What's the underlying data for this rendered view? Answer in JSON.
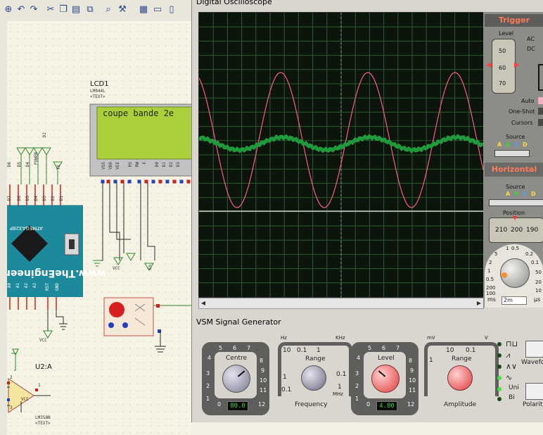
{
  "toolbar": {
    "icons": [
      "zoom-icon",
      "undo-icon",
      "redo-icon",
      "cut-icon",
      "copy-icon",
      "paste-icon",
      "tool-icon",
      "schematic-icon",
      "find-icon",
      "settings-icon",
      "netlist-icon",
      "file-icon",
      "page-icon"
    ]
  },
  "schematic": {
    "lcd": {
      "ref": "LCD1",
      "model": "LM044L",
      "text_tag": "<TEXT>",
      "display": "coupe bande 2e",
      "pins": [
        "VSS",
        "VDD",
        "VEE",
        "RS",
        "RW",
        "E",
        "D0",
        "D1",
        "D2",
        "D3"
      ]
    },
    "arduino": {
      "brand": "www.TheEngineer",
      "chip": "ATMEGA328P"
    },
    "arduino_top_pins": [
      "D9",
      "D8",
      "D7",
      "D6",
      "D5",
      "D4",
      "D3",
      "D2",
      "D1",
      "D0"
    ],
    "arduino_top_labels": [
      "D6",
      "D5",
      "D4",
      "POWER",
      "D2",
      "TX"
    ],
    "arduino_bottom_pins": [
      "A0",
      "A1",
      "A2",
      "A3",
      "A4",
      "A5",
      "RST",
      "GND"
    ],
    "net_vcc": "VCC",
    "net_en": "En",
    "opamp": {
      "ref": "U2:A",
      "model": "LM358N",
      "text_tag": "<TEXT>",
      "pin_out": "1",
      "pin_in": "2",
      "pin_in2": "3",
      "vcc": "VCC"
    }
  },
  "oscilloscope": {
    "title": "Digital Oscilloscope",
    "trigger": {
      "title": "Trigger",
      "level_label": "Level",
      "level_ticks": [
        "50",
        "60",
        "70"
      ],
      "ac": "AC",
      "dc": "DC",
      "auto": "Auto",
      "one_shot": "One-Shot",
      "cursors": "Cursors",
      "source": "Source",
      "channels": [
        "A",
        "B",
        "C",
        "D"
      ]
    },
    "horizontal": {
      "title": "Horizontal",
      "source": "Source",
      "channels": [
        "A",
        "B",
        "C",
        "D"
      ],
      "position": "Position",
      "position_values": [
        "210",
        "200",
        "190"
      ],
      "dial_ticks": [
        "1",
        "0.5",
        "0.2",
        "0.1",
        "50",
        "20",
        "10",
        "5",
        "2",
        "1",
        "0.5",
        "200",
        "100"
      ],
      "units": [
        "ms",
        "µs"
      ],
      "timebase_value": "2m"
    },
    "channel_a_color": "#ff5a8a",
    "channel_b_color": "#1f9b3c"
  },
  "generator": {
    "title": "VSM Signal Generator",
    "centre": {
      "label": "Centre",
      "scale": [
        "5",
        "6",
        "7",
        "4",
        "8",
        "3",
        "9",
        "2",
        "10",
        "1",
        "11",
        "0",
        "12"
      ],
      "value": "80.0"
    },
    "freq_range": {
      "label": "Range",
      "top": [
        "0.1",
        "1"
      ],
      "left": [
        "10",
        "1",
        "0.1"
      ],
      "right": [
        "0.1",
        "1"
      ],
      "hz": "Hz",
      "khz": "KHz",
      "mhz": "MHz",
      "caption": "Frequency"
    },
    "level": {
      "label": "Level",
      "scale": [
        "5",
        "6",
        "7",
        "4",
        "8",
        "3",
        "9",
        "2",
        "10",
        "1",
        "11",
        "0",
        "12"
      ],
      "value": "4.80"
    },
    "amp_range": {
      "label": "Range",
      "top": [
        "10",
        "0.1"
      ],
      "left": [
        "1"
      ],
      "mv": "mV",
      "v": "V",
      "caption": "Amplitude"
    },
    "waveform_caption": "Wavefor",
    "polarity": {
      "uni": "Uni",
      "bi": "Bi",
      "caption": "Polarit"
    }
  }
}
